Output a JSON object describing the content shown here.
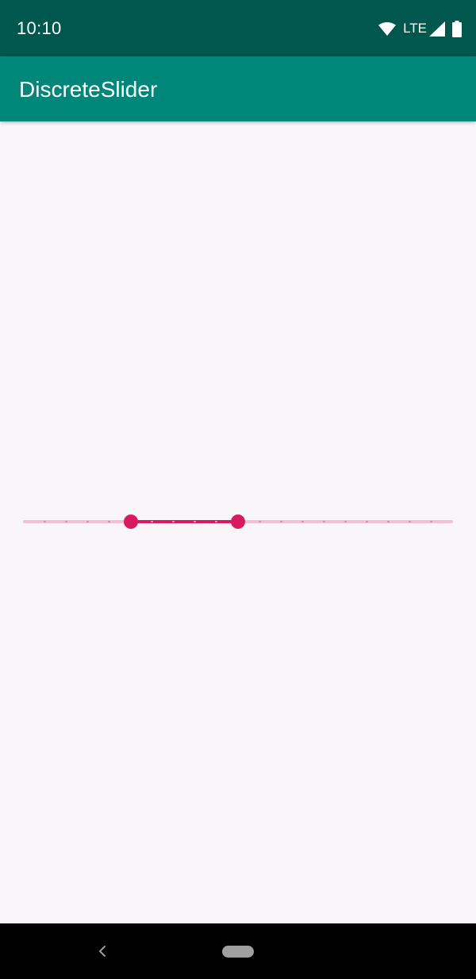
{
  "status_bar": {
    "time": "10:10",
    "network_label": "LTE",
    "icons": [
      "wifi-icon",
      "cellular-signal-icon",
      "battery-icon"
    ]
  },
  "app_bar": {
    "title": "DiscreteSlider"
  },
  "range_slider": {
    "type": "discrete-range",
    "step_count": 20,
    "start_step": 5,
    "end_step": 10,
    "colors": {
      "active": "#d81b60",
      "inactive": "#f2bfd3"
    }
  },
  "nav_bar": {
    "icons": [
      "back-icon",
      "home-pill-icon"
    ]
  },
  "colors": {
    "status_bar": "#00574d",
    "app_bar": "#00877a",
    "background": "#f8f6f8",
    "accent": "#d81b60"
  }
}
